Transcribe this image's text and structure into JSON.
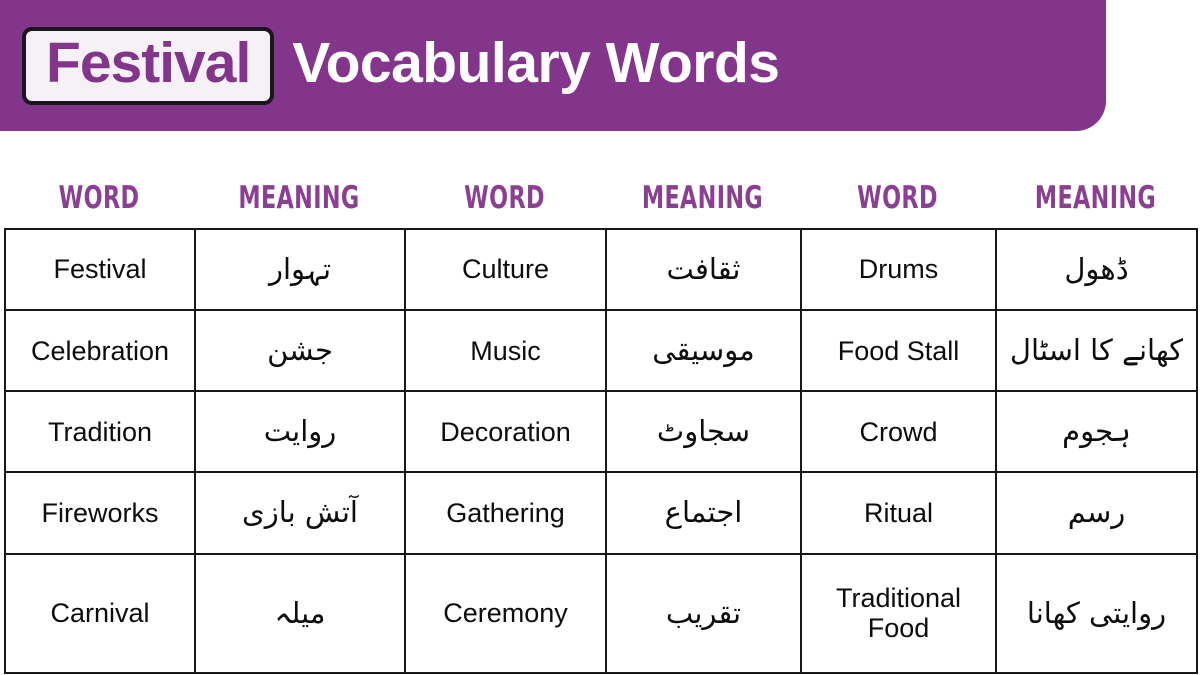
{
  "header": {
    "badge_text": "Festival",
    "title_rest": "Vocabulary Words",
    "banner_color": "#83358c",
    "badge_bg": "#f6f1f6",
    "badge_text_color": "#83358c"
  },
  "table": {
    "headers": [
      "WORD",
      "MEANING",
      "WORD",
      "MEANING",
      "WORD",
      "MEANING"
    ],
    "header_color": "#8b3f93",
    "rows": [
      {
        "word1": "Festival",
        "meaning1": "تہوار",
        "word2": "Culture",
        "meaning2": "ثقافت",
        "word3": "Drums",
        "meaning3": "ڈھول"
      },
      {
        "word1": "Celebration",
        "meaning1": "جشن",
        "word2": "Music",
        "meaning2": "موسیقی",
        "word3": "Food Stall",
        "meaning3": "کھانے کا اسٹال"
      },
      {
        "word1": "Tradition",
        "meaning1": "روایت",
        "word2": "Decoration",
        "meaning2": "سجاوٹ",
        "word3": "Crowd",
        "meaning3": "ہجوم"
      },
      {
        "word1": "Fireworks",
        "meaning1": "آتش بازی",
        "word2": "Gathering",
        "meaning2": "اجتماع",
        "word3": "Ritual",
        "meaning3": "رسم"
      },
      {
        "word1": "Carnival",
        "meaning1": "میلہ",
        "word2": "Ceremony",
        "meaning2": "تقریب",
        "word3": "Traditional Food",
        "meaning3": "روایتی کھانا"
      }
    ]
  }
}
